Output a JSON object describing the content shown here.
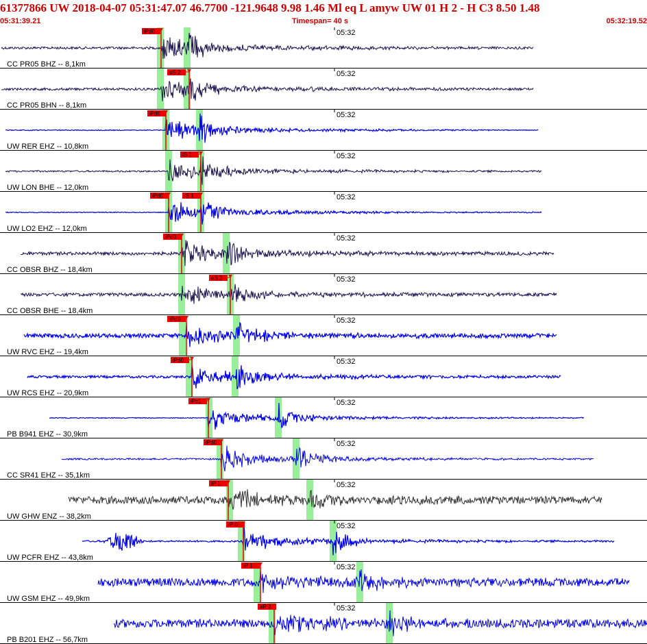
{
  "header": {
    "title": "61377866 UW 2018-04-07 05:31:47.07   46.7700 -121.9648   9.98  1.46 Ml  eq  L amyw     UW 01  H   2  -  H C3    8.50  1.48",
    "start_time": "05:31:39.21",
    "timespan": "Timespan=  40 s",
    "end_time": "05:32:19.52"
  },
  "colors": {
    "header_red": "#cc0000",
    "trace_dark": "#1a1050",
    "trace_blue": "#0000ee",
    "trace_gray": "#333333",
    "pick_red": "#ee0000",
    "shade_green": "#99ee99"
  },
  "panels": [
    {
      "label": "CC PR05 BHZ -- 8,1km",
      "tick": "05:32",
      "color": "dark",
      "picks": [
        {
          "label": "iPd0"
        }
      ]
    },
    {
      "label": "CC PR05 BHN -- 8,1km",
      "tick": "05:32",
      "color": "dark",
      "picks": [
        {
          "label": "eS 2"
        }
      ]
    },
    {
      "label": "UW RER EHZ -- 10,8km",
      "tick": "05:32",
      "color": "blue",
      "picks": [
        {
          "label": "iPd0"
        }
      ]
    },
    {
      "label": "UW LON BHE -- 12,0km",
      "tick": "05:32",
      "color": "dark",
      "picks": [
        {
          "label": "iS 1"
        }
      ]
    },
    {
      "label": "UW LO2 EHZ -- 12,0km",
      "tick": "05:32",
      "color": "blue",
      "picks": [
        {
          "label": "iPd0"
        },
        {
          "label": "iS 1"
        }
      ]
    },
    {
      "label": "CC OBSR BHZ -- 18,4km",
      "tick": "05:32",
      "color": "dark",
      "picks": [
        {
          "label": "iPd0"
        }
      ]
    },
    {
      "label": "CC OBSR BHE -- 18,4km",
      "tick": "05:32",
      "color": "dark",
      "picks": [
        {
          "label": "eS 2"
        }
      ]
    },
    {
      "label": "UW RVC EHZ -- 19,4km",
      "tick": "05:32",
      "color": "blue",
      "picks": [
        {
          "label": "iPd0"
        }
      ]
    },
    {
      "label": "UW RCS EHZ -- 20,9km",
      "tick": "05:32",
      "color": "blue",
      "picks": [
        {
          "label": "iPd0"
        }
      ]
    },
    {
      "label": "PB B941 EHZ -- 30,9km",
      "tick": "05:32",
      "color": "blue",
      "picks": [
        {
          "label": "iPc1"
        }
      ]
    },
    {
      "label": "CC SR41 EHZ -- 35,1km",
      "tick": "05:32",
      "color": "blue",
      "picks": [
        {
          "label": "iPd0"
        }
      ]
    },
    {
      "label": "UW GHW ENZ -- 38,2km",
      "tick": "05:32",
      "color": "gray",
      "picks": [
        {
          "label": "iP 1"
        }
      ]
    },
    {
      "label": "UW PCFR EHZ -- 43,8km",
      "tick": "05:32",
      "color": "blue",
      "picks": [
        {
          "label": "iP 0"
        }
      ]
    },
    {
      "label": "UW GSM EHZ -- 49,9km",
      "tick": "05:32",
      "color": "blue",
      "picks": [
        {
          "label": "iP 1"
        }
      ]
    },
    {
      "label": "PB B201 EHZ -- 56,7km",
      "tick": "05:32",
      "color": "blue",
      "picks": [
        {
          "label": "eP 2"
        }
      ]
    }
  ]
}
